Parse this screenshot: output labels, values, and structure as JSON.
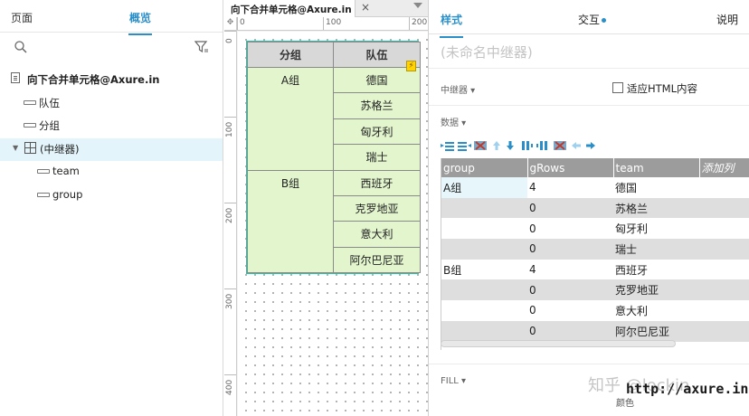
{
  "left_panel": {
    "tabs": [
      "页面",
      "概览"
    ],
    "active_tab": "概览",
    "outline": [
      {
        "label": "向下合并单元格@Axure.in",
        "type": "page"
      },
      {
        "label": "队伍",
        "type": "field"
      },
      {
        "label": "分组",
        "type": "field"
      },
      {
        "label": "(中继器)",
        "type": "repeater",
        "selected": true
      },
      {
        "label": "team",
        "type": "field"
      },
      {
        "label": "group",
        "type": "field"
      }
    ]
  },
  "canvas": {
    "doc_tab": "向下合并单元格@Axure.in",
    "close_glyph": "×",
    "ruler_h": [
      "0",
      "100",
      "200"
    ],
    "ruler_v": [
      "0",
      "100",
      "200",
      "300",
      "400"
    ],
    "repeater": {
      "headers": [
        "分组",
        "队伍"
      ],
      "rows": [
        {
          "group": "A组",
          "team": "德国"
        },
        {
          "group": "",
          "team": "苏格兰"
        },
        {
          "group": "",
          "team": "匈牙利"
        },
        {
          "group": "",
          "team": "瑞士"
        },
        {
          "group": "B组",
          "team": "西班牙"
        },
        {
          "group": "",
          "team": "克罗地亚"
        },
        {
          "group": "",
          "team": "意大利"
        },
        {
          "group": "",
          "team": "阿尔巴尼亚"
        }
      ]
    }
  },
  "right_panel": {
    "tabs": {
      "style": "样式",
      "interaction": "交互",
      "notes": "说明"
    },
    "widget_name_placeholder": "(未命名中继器)",
    "repeater_section": "中继器 ▾",
    "fit_html_label": "适应HTML内容",
    "data_section": "数据 ▾",
    "grid": {
      "columns": [
        "group",
        "gRows",
        "team",
        "添加列"
      ],
      "rows": [
        [
          "A组",
          "4",
          "德国"
        ],
        [
          "",
          "0",
          "苏格兰"
        ],
        [
          "",
          "0",
          "匈牙利"
        ],
        [
          "",
          "0",
          "瑞士"
        ],
        [
          "B组",
          "4",
          "西班牙"
        ],
        [
          "",
          "0",
          "克罗地亚"
        ],
        [
          "",
          "0",
          "意大利"
        ],
        [
          "",
          "0",
          "阿尔巴尼亚"
        ]
      ]
    },
    "fill_section": "FILL ▾",
    "color_label": "颜色",
    "watermark_zhihu": "知乎 @lockin",
    "watermark_url": "http://axure.in"
  },
  "colors": {
    "accent": "#2a8fc9",
    "repeater_cell": "#e2f5cd",
    "header_gray": "#9c9c9c"
  }
}
